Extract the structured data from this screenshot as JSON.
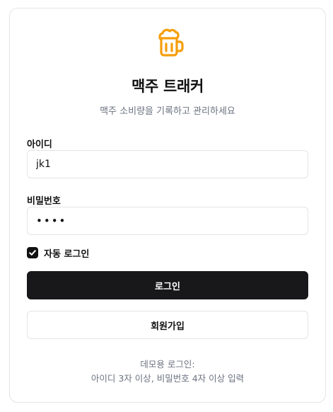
{
  "app": {
    "title": "맥주 트래커",
    "subtitle": "맥주 소비량을 기록하고 관리하세요",
    "logo_icon": "beer-mug-icon",
    "accent_color": "#f59e0b"
  },
  "form": {
    "username_label": "아이디",
    "username_value": "jk1",
    "password_label": "비밀번호",
    "password_value": "1234",
    "remember": {
      "label": "자동 로그인",
      "checked": true
    },
    "login_button": "로그인",
    "signup_button": "회원가입"
  },
  "demo": {
    "heading": "데모용 로그인:",
    "rule": "아이디 3자 이상, 비밀번호 4자 이상 입력"
  }
}
